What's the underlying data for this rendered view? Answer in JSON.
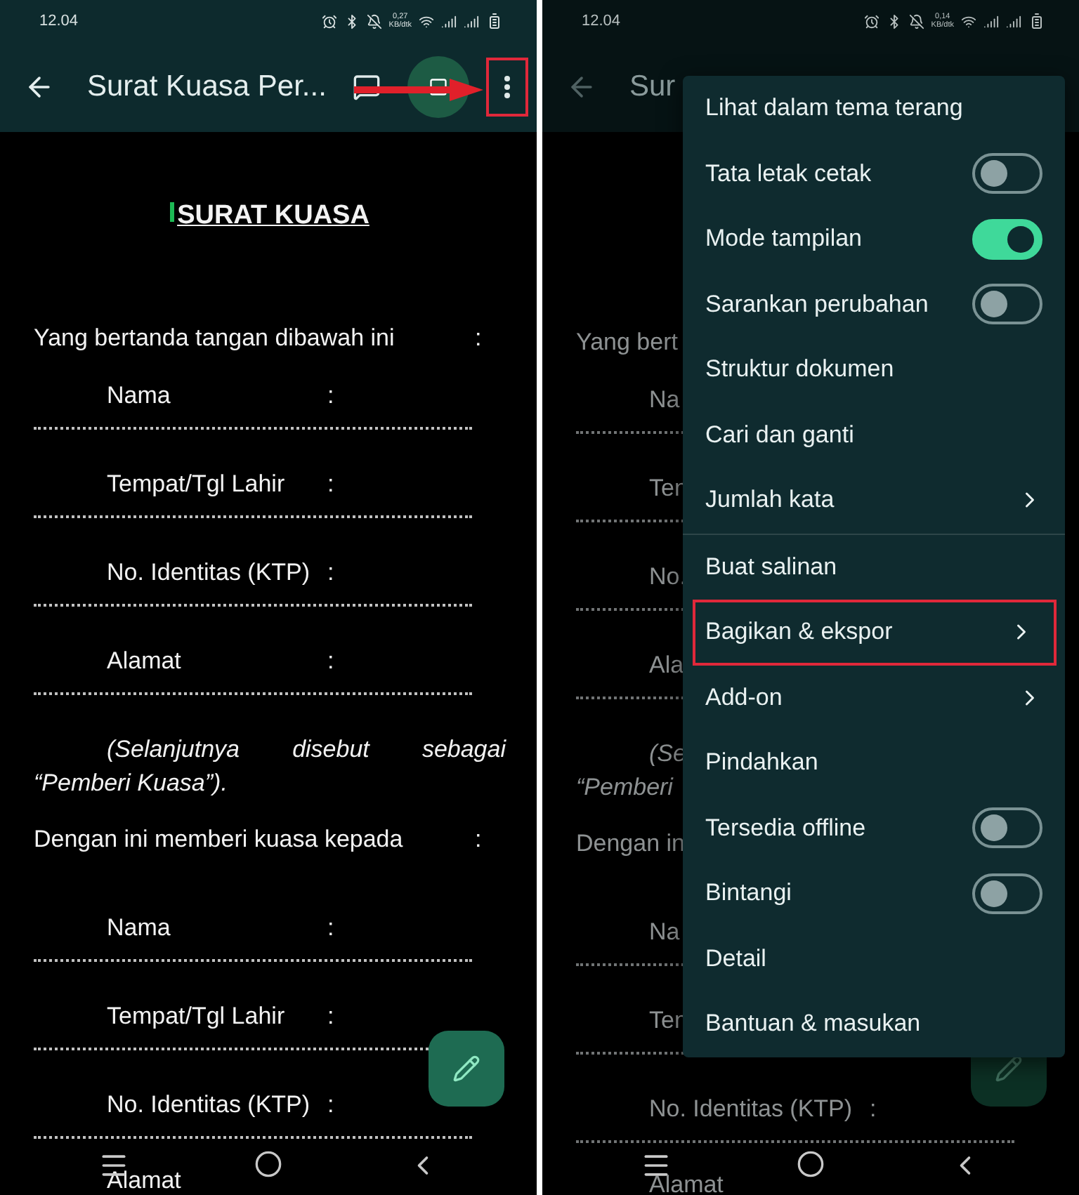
{
  "left": {
    "dim": false,
    "status_bar": {
      "time": "12.04",
      "net_speed": "0,27",
      "net_unit": "KB/dtk"
    },
    "toolbar": {
      "title": "Surat Kuasa Per...",
      "annotated": true
    },
    "document": [
      {
        "kind": "title",
        "text": "SURAT KUASA"
      },
      {
        "kind": "para",
        "text": "Yang bertanda tangan dibawah ini",
        "colon": ":"
      },
      {
        "kind": "field",
        "label": "Nama",
        "colon": ":"
      },
      {
        "kind": "field",
        "label": "Tempat/Tgl Lahir",
        "colon": ":"
      },
      {
        "kind": "field",
        "label": "No. Identitas (KTP)",
        "colon": ":"
      },
      {
        "kind": "field",
        "label": "Alamat",
        "colon": ":"
      },
      {
        "kind": "note",
        "lines": [
          "(Selanjutnya disebut sebagai",
          "“Pemberi Kuasa”)."
        ]
      },
      {
        "kind": "para",
        "text": "Dengan ini memberi kuasa kepada",
        "colon": ":"
      },
      {
        "kind": "blank"
      },
      {
        "kind": "field",
        "label": "Nama",
        "colon": ":"
      },
      {
        "kind": "field",
        "label": "Tempat/Tgl Lahir",
        "colon": ":"
      },
      {
        "kind": "field",
        "label": "No. Identitas (KTP)",
        "colon": ":"
      },
      {
        "kind": "label",
        "label": "Alamat"
      }
    ]
  },
  "right": {
    "dim": true,
    "status_bar": {
      "time": "12.04",
      "net_speed": "0,14",
      "net_unit": "KB/dtk"
    },
    "toolbar": {
      "title": "Sur"
    },
    "document": [
      {
        "kind": "para",
        "text": "Yang bert"
      },
      {
        "kind": "field",
        "label": "Na"
      },
      {
        "kind": "field",
        "label": "Ten"
      },
      {
        "kind": "field",
        "label": "No."
      },
      {
        "kind": "field",
        "label": "Ala"
      },
      {
        "kind": "note",
        "lines": [
          "(Se",
          "“Pemberi"
        ]
      },
      {
        "kind": "para",
        "text": "Dengan in"
      },
      {
        "kind": "blank"
      },
      {
        "kind": "field",
        "label": "Na"
      },
      {
        "kind": "field",
        "label": "Ten"
      },
      {
        "kind": "field",
        "label": "No. Identitas (KTP)",
        "colon": ":"
      },
      {
        "kind": "label",
        "label": "Alamat"
      }
    ],
    "menu": {
      "sections": [
        [
          {
            "kind": "plain",
            "label": "Lihat dalam tema terang"
          },
          {
            "kind": "toggle",
            "label": "Tata letak cetak",
            "on": false
          },
          {
            "kind": "toggle",
            "label": "Mode tampilan",
            "on": true
          },
          {
            "kind": "toggle",
            "label": "Sarankan perubahan",
            "on": false
          },
          {
            "kind": "plain",
            "label": "Struktur dokumen"
          },
          {
            "kind": "plain",
            "label": "Cari dan ganti"
          },
          {
            "kind": "submenu",
            "label": "Jumlah kata"
          }
        ],
        [
          {
            "kind": "plain",
            "label": "Buat salinan"
          },
          {
            "kind": "submenu",
            "label": "Bagikan & ekspor",
            "highlighted": true
          },
          {
            "kind": "submenu",
            "label": "Add-on"
          },
          {
            "kind": "plain",
            "label": "Pindahkan"
          },
          {
            "kind": "toggle",
            "label": "Tersedia offline",
            "on": false
          },
          {
            "kind": "toggle",
            "label": "Bintangi",
            "on": false
          },
          {
            "kind": "plain",
            "label": "Detail"
          },
          {
            "kind": "plain",
            "label": "Bantuan & masukan"
          }
        ]
      ]
    }
  }
}
